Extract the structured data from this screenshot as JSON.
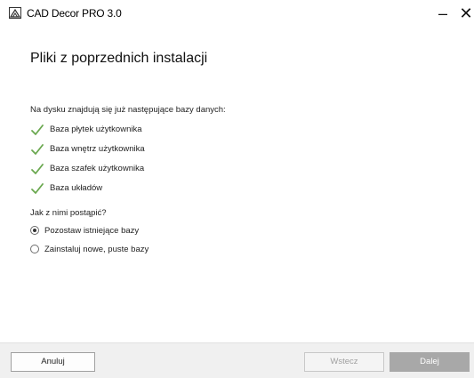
{
  "window": {
    "title": "CAD Decor PRO 3.0",
    "minimize_glyph": "–",
    "close_glyph": "✕"
  },
  "page": {
    "title": "Pliki z poprzednich instalacji",
    "intro": "Na dysku znajdują się już następujące bazy danych:",
    "databases": [
      {
        "label": "Baza płytek użytkownika",
        "icon": "check-icon"
      },
      {
        "label": "Baza wnętrz użytkownika",
        "icon": "check-icon"
      },
      {
        "label": "Baza szafek użytkownika",
        "icon": "check-icon"
      },
      {
        "label": "Baza układów",
        "icon": "check-icon"
      }
    ],
    "question": "Jak z nimi postąpić?",
    "options": [
      {
        "label": "Pozostaw istniejące bazy",
        "selected": true
      },
      {
        "label": "Zainstaluj nowe, puste bazy",
        "selected": false
      }
    ]
  },
  "footer": {
    "cancel_label": "Anuluj",
    "back_label": "Wstecz",
    "next_label": "Dalej"
  },
  "colors": {
    "check": "#6aa84f",
    "footer_bg": "#f0f0f0",
    "next_bg": "#a8a8a8"
  }
}
